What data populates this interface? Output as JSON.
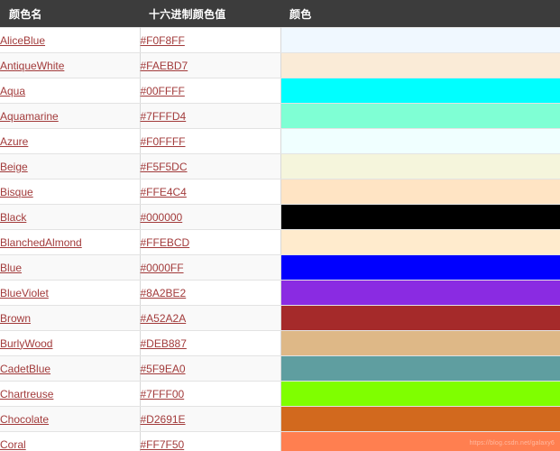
{
  "table": {
    "headers": [
      {
        "label": "颜色名"
      },
      {
        "label": "十六进制颜色值"
      },
      {
        "label": "颜色"
      }
    ],
    "rows": [
      {
        "name": "AliceBlue",
        "hex": "#F0F8FF",
        "swatch": "#F0F8FF"
      },
      {
        "name": "AntiqueWhite",
        "hex": "#FAEBD7",
        "swatch": "#FAEBD7"
      },
      {
        "name": "Aqua",
        "hex": "#00FFFF",
        "swatch": "#00FFFF"
      },
      {
        "name": "Aquamarine",
        "hex": "#7FFFD4",
        "swatch": "#7FFFD4"
      },
      {
        "name": "Azure",
        "hex": "#F0FFFF",
        "swatch": "#F0FFFF"
      },
      {
        "name": "Beige",
        "hex": "#F5F5DC",
        "swatch": "#F5F5DC"
      },
      {
        "name": "Bisque",
        "hex": "#FFE4C4",
        "swatch": "#FFE4C4"
      },
      {
        "name": "Black",
        "hex": "#000000",
        "swatch": "#000000"
      },
      {
        "name": "BlanchedAlmond",
        "hex": "#FFEBCD",
        "swatch": "#FFEBCD"
      },
      {
        "name": "Blue",
        "hex": "#0000FF",
        "swatch": "#0000FF"
      },
      {
        "name": "BlueViolet",
        "hex": "#8A2BE2",
        "swatch": "#8A2BE2"
      },
      {
        "name": "Brown",
        "hex": "#A52A2A",
        "swatch": "#A52A2A"
      },
      {
        "name": "BurlyWood",
        "hex": "#DEB887",
        "swatch": "#DEB887"
      },
      {
        "name": "CadetBlue",
        "hex": "#5F9EA0",
        "swatch": "#5F9EA0"
      },
      {
        "name": "Chartreuse",
        "hex": "#7FFF00",
        "swatch": "#7FFF00"
      },
      {
        "name": "Chocolate",
        "hex": "#D2691E",
        "swatch": "#D2691E"
      },
      {
        "name": "Coral",
        "hex": "#FF7F50",
        "swatch": "#FF7F50"
      }
    ]
  },
  "watermark": {
    "text": "https://blog.csdn.net/galaxy6"
  },
  "theme": {
    "header_background": "#3C3C3C",
    "header_text": "#FFFFFF",
    "link_color": "#A23B3B",
    "row_background": "#FFFFFF",
    "row_background_alt": "#F9F9F9",
    "border_color": "#E3E3E3"
  }
}
